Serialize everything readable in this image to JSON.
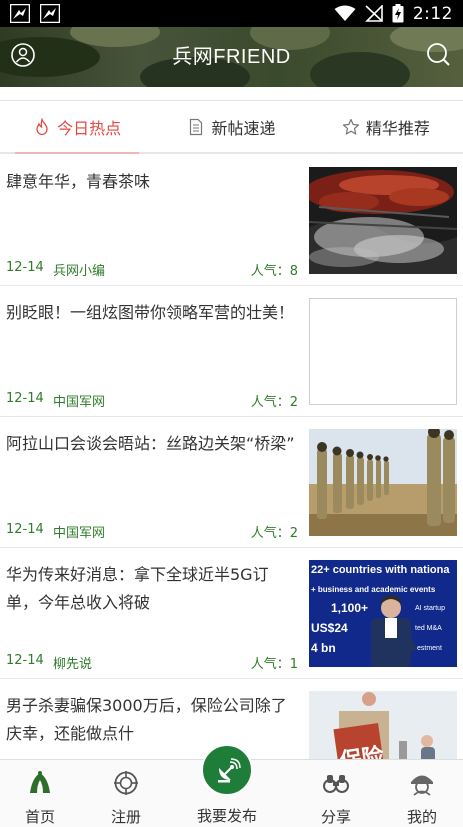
{
  "status_bar": {
    "time": "2:12"
  },
  "header": {
    "title": "兵网FRIEND"
  },
  "tabs": [
    {
      "label": "今日热点"
    },
    {
      "label": "新帖速递"
    },
    {
      "label": "精华推荐"
    }
  ],
  "feed": [
    {
      "title": "肆意年华，青春茶味",
      "date": "12-14",
      "source": "兵网小编",
      "popularity": "人气：8"
    },
    {
      "title": "别眨眼！一组炫图带你领略军营的壮美！",
      "date": "12-14",
      "source": "中国军网",
      "popularity": "人气：2"
    },
    {
      "title": "阿拉山口会谈会晤站：丝路边关架“桥梁”",
      "date": "12-14",
      "source": "中国军网",
      "popularity": "人气：2"
    },
    {
      "title": "华为传来好消息：拿下全球近半5G订单，今年总收入将破",
      "date": "12-14",
      "source": "柳先说",
      "popularity": "人气：1"
    },
    {
      "title": "男子杀妻骗保3000万后，保险公司除了庆幸，还能做点什",
      "date": "",
      "source": "",
      "popularity": ""
    }
  ],
  "thumb_text": {
    "huawei_line1": "22+ countries with nationa",
    "huawei_line2": "+ business and academic events",
    "huawei_line3": "1,100+",
    "huawei_line3b": "AI startup",
    "huawei_line4": "US$24",
    "huawei_line4b": "ted M&A",
    "huawei_line5": "4 bn",
    "huawei_line5b": "estment",
    "insurance_sign": "保险"
  },
  "bottom_nav": {
    "home": "首页",
    "register": "注册",
    "publish": "我要发布",
    "share": "分享",
    "mine": "我的"
  },
  "colors": {
    "accent_red": "#e24a44",
    "meta_green": "#2f7d2a",
    "publish_green": "#1f7d3a"
  }
}
